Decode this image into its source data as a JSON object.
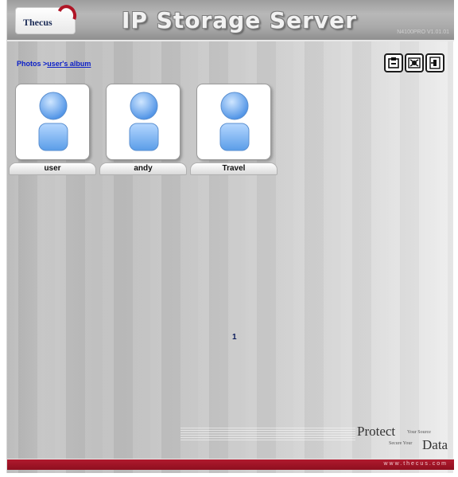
{
  "header": {
    "logo_text": "Thecus",
    "title": "IP Storage Server",
    "version": "N4100PRO V1.01.01"
  },
  "breadcrumb": {
    "root": "Photos >",
    "current": "user's album"
  },
  "toolbar": {
    "icons": [
      "upload-icon",
      "settings-icon",
      "exit-icon"
    ]
  },
  "albums": [
    {
      "label": "user",
      "icon": "user-album-icon"
    },
    {
      "label": "andy",
      "icon": "user-album-icon"
    },
    {
      "label": "Travel",
      "icon": "user-album-icon"
    }
  ],
  "pagination": {
    "current_page": "1"
  },
  "footer": {
    "slogan_protect": "Protect",
    "slogan_sub1": "Your Source",
    "slogan_sub2": "Secure Your",
    "slogan_data": "Data",
    "url": "www.thecus.com"
  },
  "colors": {
    "link": "#0a1ec8",
    "footer_bar": "#a0162a",
    "title": "#f2f2f2"
  }
}
